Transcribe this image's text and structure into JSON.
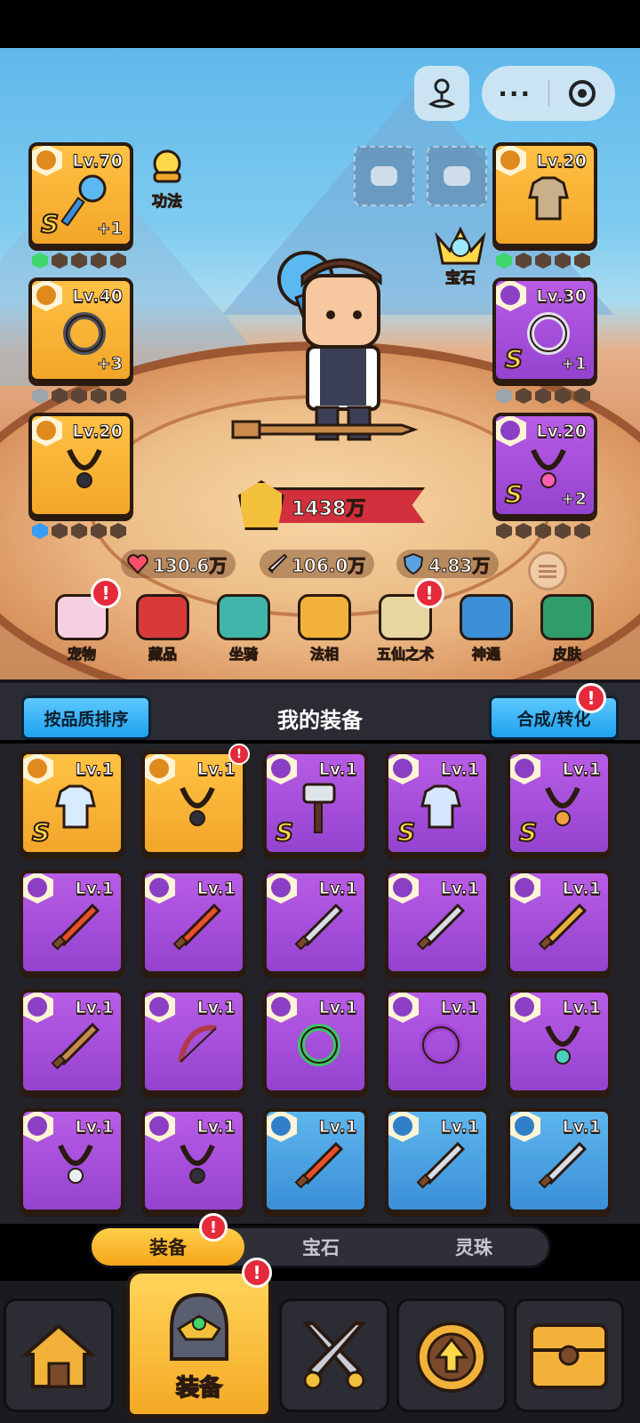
{
  "capsule": {
    "pin_icon": "person-pin-icon",
    "more_label": "···",
    "close_icon": "record-icon"
  },
  "left_slots": [
    {
      "level": "Lv.70",
      "grade": "S",
      "plus": "+1",
      "quality": "gold",
      "item": "blue-orb-staff",
      "gems": [
        "green",
        "dark",
        "dark",
        "dark",
        "dark"
      ]
    },
    {
      "level": "Lv.40",
      "grade": "",
      "plus": "+3",
      "quality": "gold",
      "item": "dark-ring",
      "gems": [
        "gray",
        "dark",
        "dark",
        "dark",
        "dark"
      ]
    },
    {
      "level": "Lv.20",
      "grade": "",
      "plus": "",
      "quality": "gold",
      "item": "cord-necklace",
      "gems": [
        "blue",
        "dark",
        "dark",
        "dark",
        "dark"
      ]
    }
  ],
  "right_slots": [
    {
      "level": "Lv.20",
      "grade": "",
      "plus": "",
      "quality": "gold",
      "item": "cloth-shirt",
      "gems": [
        "green",
        "dark",
        "dark",
        "dark",
        "dark"
      ]
    },
    {
      "level": "Lv.30",
      "grade": "S",
      "plus": "+1",
      "quality": "purple",
      "item": "gold-ring",
      "gems": [
        "gray",
        "dark",
        "dark",
        "dark",
        "dark"
      ]
    },
    {
      "level": "Lv.20",
      "grade": "S",
      "plus": "+2",
      "quality": "purple",
      "item": "heart-pendant",
      "gems": [
        "dark",
        "dark",
        "dark",
        "dark",
        "dark"
      ]
    }
  ],
  "labels": {
    "skill": "功法",
    "gem": "宝石"
  },
  "power": "1438万",
  "stats": {
    "hp": "130.6万",
    "atk": "106.0万",
    "def": "4.83万"
  },
  "features": [
    {
      "label": "宠物",
      "badge": "!"
    },
    {
      "label": "藏品",
      "badge": ""
    },
    {
      "label": "坐骑",
      "badge": ""
    },
    {
      "label": "法相",
      "badge": ""
    },
    {
      "label": "五仙之术",
      "badge": "!"
    },
    {
      "label": "神通",
      "badge": ""
    },
    {
      "label": "皮肤",
      "badge": ""
    }
  ],
  "panel": {
    "sort_label": "按品质排序",
    "title": "我的装备",
    "merge_label": "合成/转化",
    "merge_badge": "!"
  },
  "inventory": [
    {
      "level": "Lv.1",
      "grade": "S",
      "quality": "gold",
      "item": "robe",
      "badge": ""
    },
    {
      "level": "Lv.1",
      "grade": "",
      "quality": "gold",
      "item": "cord-necklace",
      "badge": "!"
    },
    {
      "level": "Lv.1",
      "grade": "S",
      "quality": "purple",
      "item": "hammer",
      "badge": ""
    },
    {
      "level": "Lv.1",
      "grade": "S",
      "quality": "purple",
      "item": "armor",
      "badge": ""
    },
    {
      "level": "Lv.1",
      "grade": "S",
      "quality": "purple",
      "item": "amulet",
      "badge": ""
    },
    {
      "level": "Lv.1",
      "grade": "",
      "quality": "purple",
      "item": "flame-blade",
      "badge": ""
    },
    {
      "level": "Lv.1",
      "grade": "",
      "quality": "purple",
      "item": "flame-blade",
      "badge": ""
    },
    {
      "level": "Lv.1",
      "grade": "",
      "quality": "purple",
      "item": "silver-sword",
      "badge": ""
    },
    {
      "level": "Lv.1",
      "grade": "",
      "quality": "purple",
      "item": "silver-sword",
      "badge": ""
    },
    {
      "level": "Lv.1",
      "grade": "",
      "quality": "purple",
      "item": "gold-sword",
      "badge": ""
    },
    {
      "level": "Lv.1",
      "grade": "",
      "quality": "purple",
      "item": "spear",
      "badge": ""
    },
    {
      "level": "Lv.1",
      "grade": "",
      "quality": "purple",
      "item": "bow",
      "badge": ""
    },
    {
      "level": "Lv.1",
      "grade": "",
      "quality": "purple",
      "item": "jade-ring",
      "badge": ""
    },
    {
      "level": "Lv.1",
      "grade": "",
      "quality": "purple",
      "item": "purple-ring",
      "badge": ""
    },
    {
      "level": "Lv.1",
      "grade": "",
      "quality": "purple",
      "item": "pendant",
      "badge": ""
    },
    {
      "level": "Lv.1",
      "grade": "",
      "quality": "purple",
      "item": "eye-necklace",
      "badge": ""
    },
    {
      "level": "Lv.1",
      "grade": "",
      "quality": "purple",
      "item": "cord-necklace",
      "badge": ""
    },
    {
      "level": "Lv.1",
      "grade": "",
      "quality": "blue",
      "item": "flame-blade",
      "badge": ""
    },
    {
      "level": "Lv.1",
      "grade": "",
      "quality": "blue",
      "item": "silver-sword",
      "badge": ""
    },
    {
      "level": "Lv.1",
      "grade": "",
      "quality": "blue",
      "item": "silver-sword",
      "badge": ""
    }
  ],
  "tabs": [
    {
      "label": "装备",
      "badge": "!"
    },
    {
      "label": "宝石",
      "badge": ""
    },
    {
      "label": "灵珠",
      "badge": ""
    }
  ],
  "bottom_nav": {
    "equip_label": "装备",
    "equip_badge": "!"
  },
  "colors": {
    "gold": "#f2a62a",
    "purple": "#9443cf",
    "blue": "#3a8fd6",
    "badge": "#e52a3b",
    "power_ribbon": "#d1303c"
  }
}
